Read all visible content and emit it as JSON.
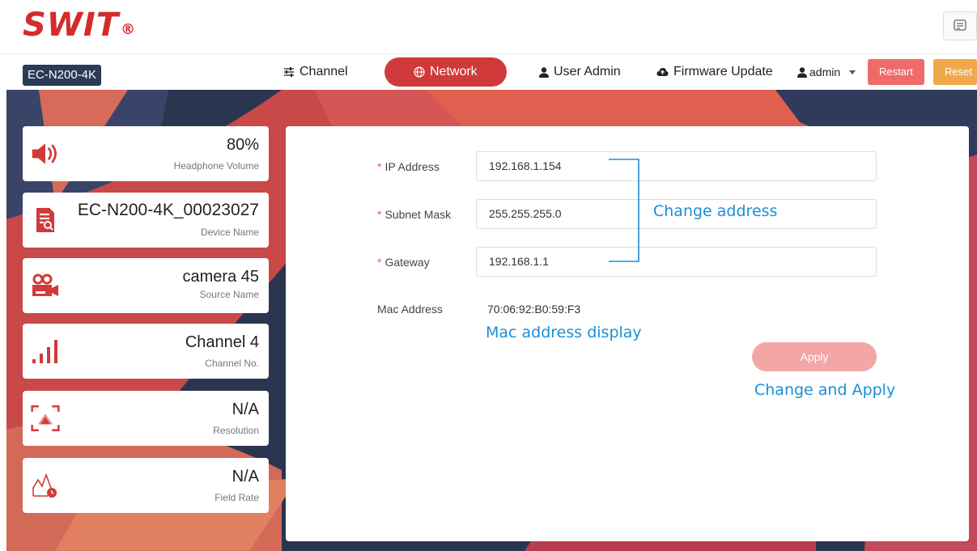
{
  "brand": {
    "logo": "SWIT",
    "registered": "®"
  },
  "header": {
    "chat_icon": "message-icon"
  },
  "nav": {
    "device": "EC-N200-4K",
    "tabs": [
      {
        "label": "Channel",
        "icon": "sliders-icon"
      },
      {
        "label": "Network",
        "icon": "globe-icon",
        "active": true
      },
      {
        "label": "User Admin",
        "icon": "user-icon"
      },
      {
        "label": "Firmware Update",
        "icon": "cloud-upload-icon"
      }
    ],
    "user": "admin",
    "restart_label": "Restart",
    "reset_label": "Reset"
  },
  "cards": [
    {
      "value": "80%",
      "label": "Headphone Volume",
      "icon": "speaker-icon"
    },
    {
      "value": "EC-N200-4K_00023027",
      "label": "Device Name",
      "icon": "device-search-icon"
    },
    {
      "value": "camera 45",
      "label": "Source Name",
      "icon": "video-camera-icon"
    },
    {
      "value": "Channel 4",
      "label": "Channel No.",
      "icon": "signal-bars-icon"
    },
    {
      "value": "N/A",
      "label": "Resolution",
      "icon": "resolution-icon"
    },
    {
      "value": "N/A",
      "label": "Field Rate",
      "icon": "field-rate-icon"
    }
  ],
  "network": {
    "ip_label": "IP Address",
    "ip_value": "192.168.1.154",
    "subnet_label": "Subnet Mask",
    "subnet_value": "255.255.255.0",
    "gateway_label": "Gateway",
    "gateway_value": "192.168.1.1",
    "mac_label": "Mac Address",
    "mac_value": "70:06:92:B0:59:F3",
    "apply_label": "Apply",
    "required_mark": "*"
  },
  "annotations": {
    "change_address": "Change address",
    "mac_display": "Mac address display",
    "change_apply": "Change and Apply"
  },
  "colors": {
    "brand_red": "#d42b2b",
    "active_tab": "#d03a3a",
    "restart": "#f06a6a",
    "reset": "#f0a94a",
    "annotation": "#1a8fd6"
  }
}
